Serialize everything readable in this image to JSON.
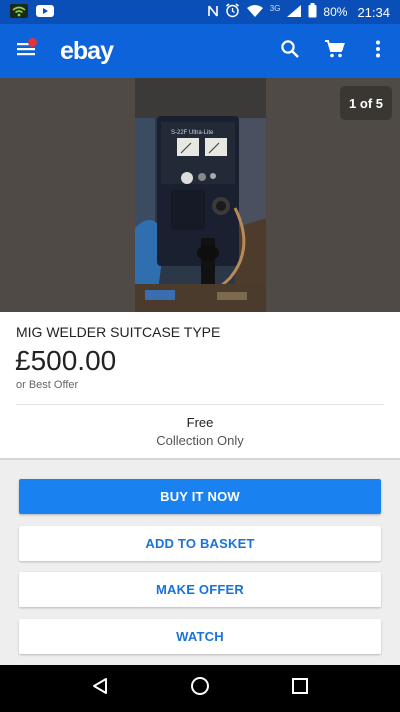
{
  "status_bar": {
    "battery": "80%",
    "time": "21:34",
    "network_type": "3G",
    "icons": [
      "wifi-icon",
      "youtube-icon",
      "nfc-icon",
      "alarm-icon",
      "signal-icon",
      "battery-icon"
    ]
  },
  "app_bar": {
    "logo": "ebay",
    "icons": [
      "menu-icon",
      "search-icon",
      "cart-icon",
      "more-icon"
    ],
    "notification_color": "#e53238"
  },
  "gallery": {
    "counter": "1 of 5"
  },
  "listing": {
    "title": "MIG WELDER SUITCASE TYPE",
    "price": "£500.00",
    "offer_note": "or Best Offer",
    "postage_price": "Free",
    "postage_method": "Collection Only"
  },
  "actions": {
    "buy_now": "BUY IT NOW",
    "add_to_basket": "ADD TO BASKET",
    "make_offer": "MAKE OFFER",
    "watch": "WATCH"
  },
  "nav_bar": {
    "icons": [
      "back-icon",
      "home-icon",
      "recents-icon"
    ]
  },
  "colors": {
    "status_bar": "#0a4fb8",
    "app_bar": "#0d63d9",
    "primary_button": "#1a82f0",
    "link_text": "#1a73d9"
  }
}
